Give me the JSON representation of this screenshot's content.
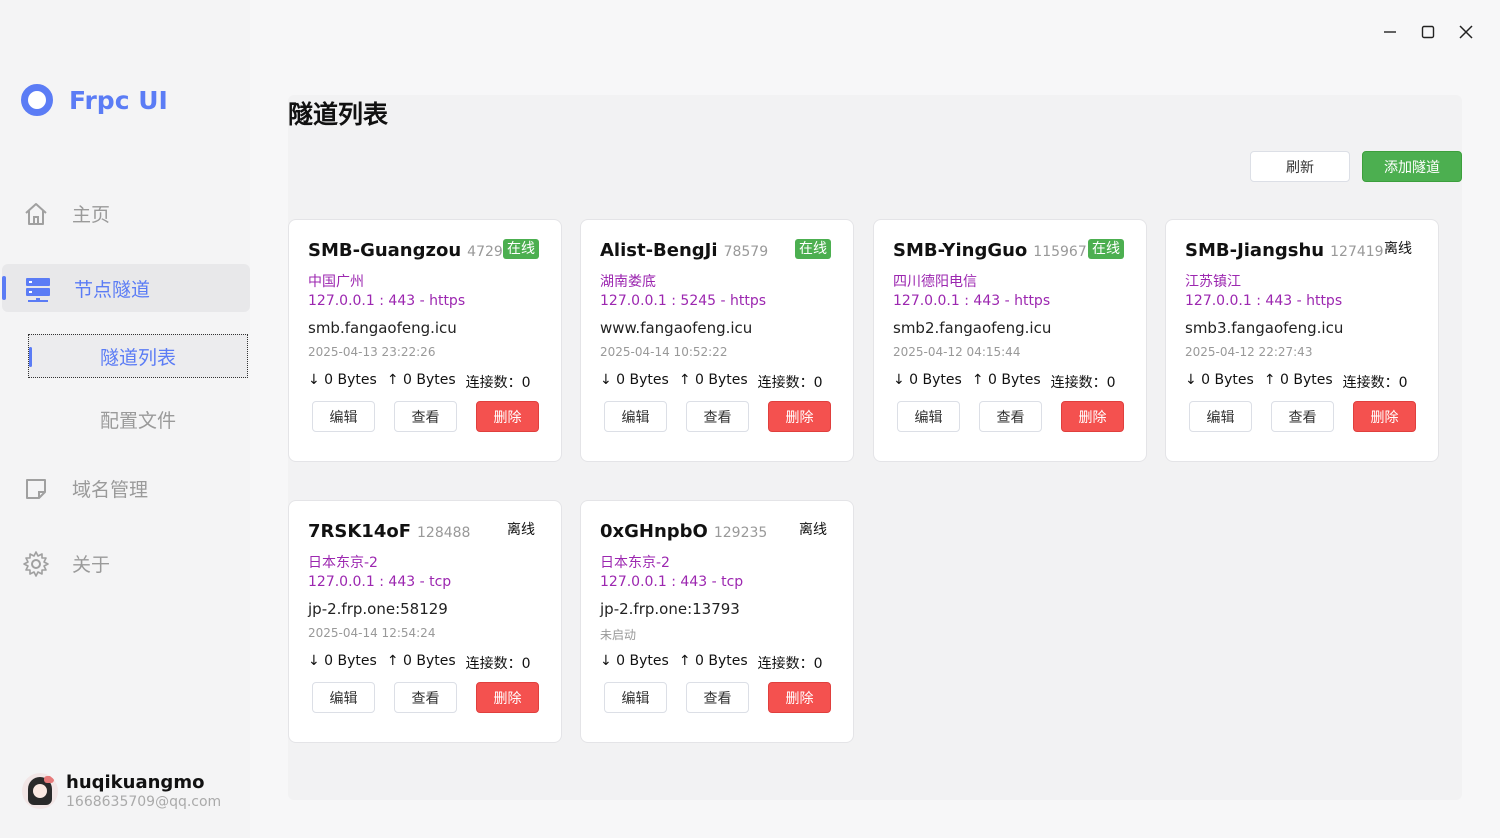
{
  "app": {
    "name": "Frpc UI"
  },
  "sidebar": {
    "items": [
      {
        "label": "主页",
        "icon": "home-icon"
      },
      {
        "label": "节点隧道",
        "icon": "server-icon"
      },
      {
        "label": "域名管理",
        "icon": "tag-icon"
      },
      {
        "label": "关于",
        "icon": "gear-icon"
      }
    ],
    "subitems": [
      {
        "label": "隧道列表"
      },
      {
        "label": "配置文件"
      }
    ]
  },
  "user": {
    "name": "huqikuangmo",
    "email": "1668635709@qq.com"
  },
  "page": {
    "title": "隧道列表"
  },
  "toolbar": {
    "refresh_label": "刷新",
    "add_label": "添加隧道"
  },
  "colors": {
    "accent": "#5b7cf5",
    "online": "#4caf50",
    "danger": "#f4514f",
    "region": "#9c27b0"
  },
  "card_buttons": {
    "edit": "编辑",
    "view": "查看",
    "delete": "删除"
  },
  "tunnels": [
    {
      "name": "SMB-Guangzou",
      "id": "47299",
      "status": "在线",
      "online": true,
      "region": "中国广州",
      "addr": "127.0.0.1 : 443 - https",
      "domain": "smb.fangaofeng.icu",
      "time": "2025-04-13 23:22:26",
      "down": "↓ 0 Bytes",
      "up": "↑ 0 Bytes",
      "conns": "连接数：0"
    },
    {
      "name": "Alist-BengJi",
      "id": "78579",
      "status": "在线",
      "online": true,
      "region": "湖南娄底",
      "addr": "127.0.0.1 : 5245 - https",
      "domain": "www.fangaofeng.icu",
      "time": "2025-04-14 10:52:22",
      "down": "↓ 0 Bytes",
      "up": "↑ 0 Bytes",
      "conns": "连接数：0"
    },
    {
      "name": "SMB-YingGuo",
      "id": "115967",
      "status": "在线",
      "online": true,
      "region": "四川德阳电信",
      "addr": "127.0.0.1 : 443 - https",
      "domain": "smb2.fangaofeng.icu",
      "time": "2025-04-12 04:15:44",
      "down": "↓ 0 Bytes",
      "up": "↑ 0 Bytes",
      "conns": "连接数：0"
    },
    {
      "name": "SMB-Jiangshu",
      "id": "127419",
      "status": "离线",
      "online": false,
      "region": "江苏镇江",
      "addr": "127.0.0.1 : 443 - https",
      "domain": "smb3.fangaofeng.icu",
      "time": "2025-04-12 22:27:43",
      "down": "↓ 0 Bytes",
      "up": "↑ 0 Bytes",
      "conns": "连接数：0"
    },
    {
      "name": "7RSK14oF",
      "id": "128488",
      "status": "离线",
      "online": false,
      "region": "日本东京-2",
      "addr": "127.0.0.1 : 443 - tcp",
      "domain": "jp-2.frp.one:58129",
      "time": "2025-04-14 12:54:24",
      "down": "↓ 0 Bytes",
      "up": "↑ 0 Bytes",
      "conns": "连接数：0"
    },
    {
      "name": "0xGHnpbO",
      "id": "129235",
      "status": "离线",
      "online": false,
      "region": "日本东京-2",
      "addr": "127.0.0.1 : 443 - tcp",
      "domain": "jp-2.frp.one:13793",
      "time": "未启动",
      "down": "↓ 0 Bytes",
      "up": "↑ 0 Bytes",
      "conns": "连接数：0"
    }
  ]
}
